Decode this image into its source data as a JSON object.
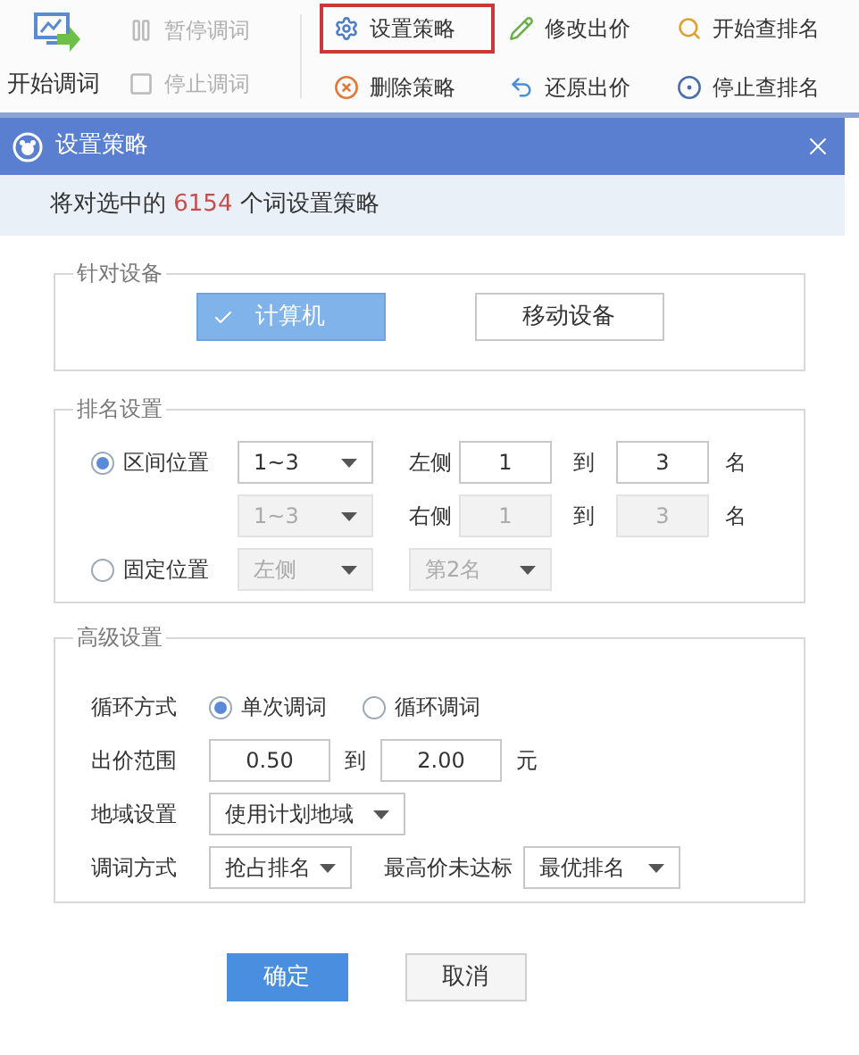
{
  "toolbar": {
    "start": {
      "label": "开始调词"
    },
    "left_items": [
      {
        "label": "暂停调词",
        "kind": "pause",
        "disabled": true
      },
      {
        "label": "停止调词",
        "kind": "stop",
        "disabled": true
      }
    ],
    "items": [
      {
        "label": "设置策略",
        "kind": "gear",
        "selected": true
      },
      {
        "label": "修改出价",
        "kind": "pencil",
        "selected": false
      },
      {
        "label": "开始查排名",
        "kind": "search",
        "selected": false
      },
      {
        "label": "删除策略",
        "kind": "delete",
        "selected": false
      },
      {
        "label": "还原出价",
        "kind": "undo",
        "selected": false
      },
      {
        "label": "停止查排名",
        "kind": "stop-circle",
        "selected": false
      }
    ]
  },
  "dialog": {
    "title": "设置策略",
    "info_parts": [
      "将对选中的",
      "6154",
      "个词设置策略"
    ],
    "device": {
      "legend": "针对设备",
      "options": [
        {
          "label": "计算机",
          "selected": true
        },
        {
          "label": "移动设备",
          "selected": false
        }
      ]
    },
    "ranking": {
      "legend": "排名设置",
      "range": {
        "label": "区间位置",
        "selected": true
      },
      "range_rows": [
        {
          "dropdown": "1~3",
          "side": "左侧",
          "from": "1",
          "to_label": "到",
          "to": "3",
          "unit": "名",
          "disabled": false
        },
        {
          "dropdown": "1~3",
          "side": "右侧",
          "from": "1",
          "to_label": "到",
          "to": "3",
          "unit": "名",
          "disabled": true
        }
      ],
      "fixed": {
        "label": "固定位置",
        "selected": false,
        "side": "左侧",
        "rank": "第2名",
        "disabled": true
      }
    },
    "advanced": {
      "legend": "高级设置",
      "loop": {
        "label": "循环方式",
        "options": [
          {
            "label": "单次调词",
            "selected": true
          },
          {
            "label": "循环调词",
            "selected": false
          }
        ]
      },
      "price": {
        "label": "出价范围",
        "min": "0.50",
        "to_label": "到",
        "max": "2.00",
        "unit": "元"
      },
      "region": {
        "label": "地域设置",
        "value": "使用计划地域"
      },
      "adjust": {
        "label": "调词方式",
        "value": "抢占排名",
        "max_label": "最高价未达标",
        "max_value": "最优排名"
      }
    },
    "buttons": [
      {
        "label": "确定",
        "kind": "primary"
      },
      {
        "label": "取消",
        "kind": "secondary"
      }
    ]
  }
}
